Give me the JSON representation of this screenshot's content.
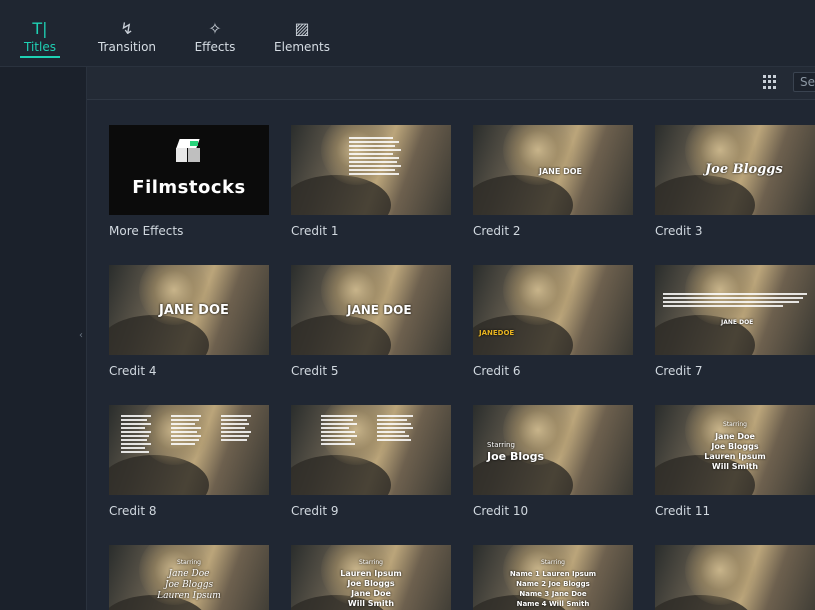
{
  "tabs": [
    {
      "label": "Titles",
      "icon": "titles-icon",
      "active": true
    },
    {
      "label": "Transition",
      "icon": "transition-icon",
      "active": false
    },
    {
      "label": "Effects",
      "icon": "effects-icon",
      "active": false
    },
    {
      "label": "Elements",
      "icon": "elements-icon",
      "active": false
    }
  ],
  "toolbar": {
    "search_placeholder": "Se"
  },
  "accent_color": "#1fd1b4",
  "items": [
    {
      "label": "More Effects",
      "logo_text": "Filmstocks"
    },
    {
      "label": "Credit 1"
    },
    {
      "label": "Credit 2",
      "overlay": "JANE DOE"
    },
    {
      "label": "Credit 3",
      "overlay": "Joe Bloggs"
    },
    {
      "label": "Credit 4",
      "overlay": "JANE DOE"
    },
    {
      "label": "Credit 5",
      "overlay": "JANE DOE"
    },
    {
      "label": "Credit 6",
      "overlay": "JANEDOE"
    },
    {
      "label": "Credit 7",
      "overlay": "JANE DOE"
    },
    {
      "label": "Credit 8"
    },
    {
      "label": "Credit 9"
    },
    {
      "label": "Credit 10",
      "overlay_small": "Starring",
      "overlay": "Joe Blogs"
    },
    {
      "label": "Credit 11",
      "overlay_small": "Starring",
      "overlay_list": [
        "Jane Doe",
        "Joe Bloggs",
        "Lauren Ipsum",
        "Will Smith"
      ]
    },
    {
      "label": "",
      "overlay_small": "Starring",
      "overlay_list": [
        "Jane Doe",
        "Joe Bloggs",
        "Lauren Ipsum"
      ]
    },
    {
      "label": "",
      "overlay_small": "Starring",
      "overlay_list": [
        "Lauren Ipsum",
        "Joe Bloggs",
        "Jane Doe",
        "Will Smith"
      ]
    },
    {
      "label": "",
      "overlay_small": "Starring",
      "overlay_list": [
        "Name 1 Lauren Ipsum",
        "Name 2 Joe Bloggs",
        "Name 3 Jane Doe",
        "Name 4 Will Smith"
      ]
    },
    {
      "label": ""
    }
  ]
}
